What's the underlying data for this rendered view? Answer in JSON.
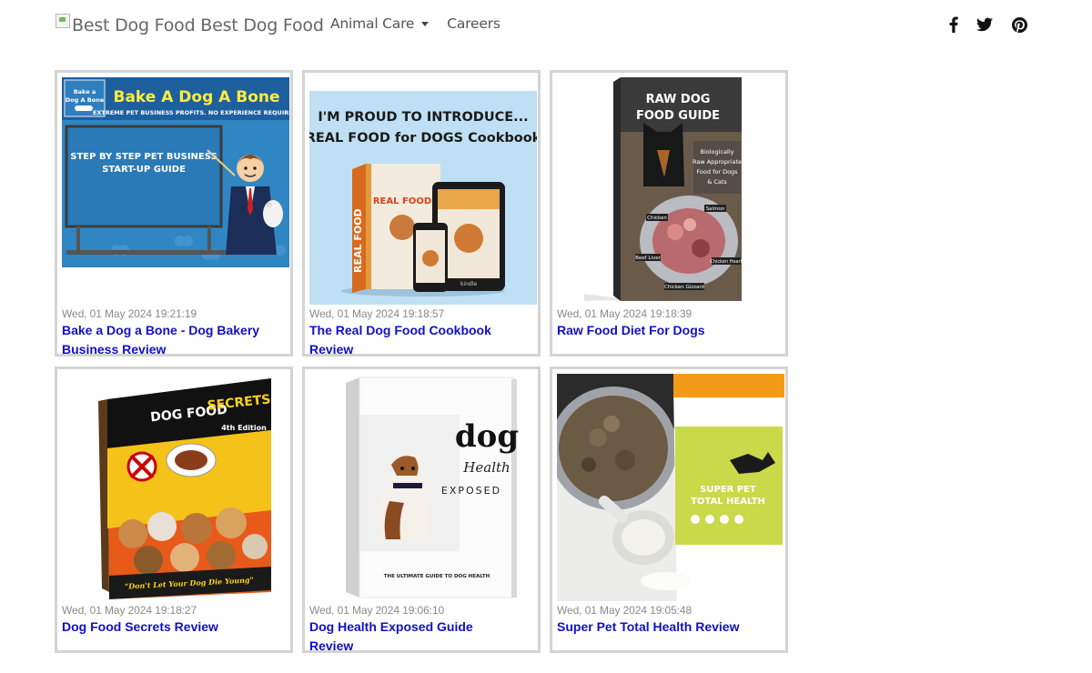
{
  "nav": {
    "brand_text": "Best Dog Food Best Dog Food",
    "links": [
      {
        "label": "Animal Care",
        "has_dropdown": true
      },
      {
        "label": "Careers",
        "has_dropdown": false
      }
    ],
    "social": [
      "facebook-icon",
      "twitter-icon",
      "pinterest-icon"
    ]
  },
  "cards": [
    {
      "date": "Wed, 01 May 2024 19:21:19",
      "title": "Bake a Dog a Bone - Dog Bakery Business Review",
      "image": {
        "banner_title": "Bake A Dog A Bone",
        "banner_sub": "EXTREME PET BUSINESS PROFITS. NO EXPERIENCE REQUIRED!",
        "badge_line1": "Bake a",
        "badge_line2": "Dog A Bone",
        "board_line1": "STEP BY STEP PET BUSINESS",
        "board_line2": "START-UP GUIDE"
      }
    },
    {
      "date": "Wed, 01 May 2024 19:18:57",
      "title": "The Real Dog Food Cookbook Review",
      "image": {
        "headline1": "I'M PROUD TO INTRODUCE...",
        "headline2": "REAL FOOD for DOGS Cookbook",
        "book_spine": "REAL FOOD",
        "book_cover": "REAL FOOD",
        "tablet_label": "kindle"
      }
    },
    {
      "date": "Wed, 01 May 2024 19:18:39",
      "title": "Raw Food Diet For Dogs",
      "image": {
        "title1": "RAW DOG",
        "title2": "FOOD GUIDE",
        "tagline": [
          "Biologically",
          "Raw Appropriate",
          "Food for Dogs",
          "& Cats"
        ],
        "labels": [
          "Chicken",
          "Salmon",
          "Beef Liver",
          "Chicken Heart",
          "Chicken Gizzard"
        ]
      }
    },
    {
      "date": "Wed, 01 May 2024 19:18:27",
      "title": "Dog Food Secrets Review",
      "image": {
        "title1": "DOG FOOD",
        "title2": "SECRETS",
        "edition": "4th Edition",
        "bottom": "\"Don't Let Your Dog Die Young\""
      }
    },
    {
      "date": "Wed, 01 May 2024 19:06:10",
      "title": "Dog Health Exposed Guide Review",
      "image": {
        "word_dog": "dog",
        "word_health": "Health",
        "word_exposed": "EXPOSED",
        "footer": "THE ULTIMATE GUIDE TO DOG HEALTH"
      }
    },
    {
      "date": "Wed, 01 May 2024 19:05:48",
      "title": "Super Pet Total Health Review",
      "image": {
        "label_line1": "SUPER PET",
        "label_line2": "TOTAL HEALTH"
      }
    }
  ],
  "colors": {
    "link": "#1010c8",
    "date": "#8a8a8a",
    "card_border": "#d4d4d4"
  }
}
